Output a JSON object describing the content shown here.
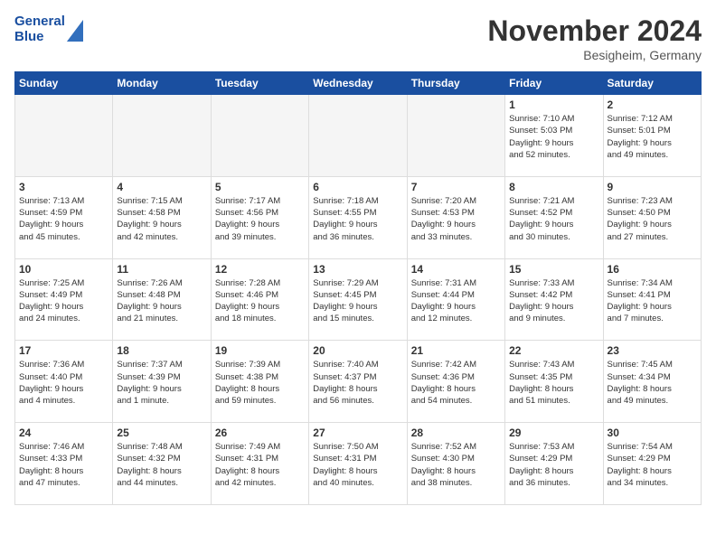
{
  "header": {
    "logo_line1": "General",
    "logo_line2": "Blue",
    "month_title": "November 2024",
    "location": "Besigheim, Germany"
  },
  "days_of_week": [
    "Sunday",
    "Monday",
    "Tuesday",
    "Wednesday",
    "Thursday",
    "Friday",
    "Saturday"
  ],
  "weeks": [
    [
      {
        "day": "",
        "info": ""
      },
      {
        "day": "",
        "info": ""
      },
      {
        "day": "",
        "info": ""
      },
      {
        "day": "",
        "info": ""
      },
      {
        "day": "",
        "info": ""
      },
      {
        "day": "1",
        "info": "Sunrise: 7:10 AM\nSunset: 5:03 PM\nDaylight: 9 hours\nand 52 minutes."
      },
      {
        "day": "2",
        "info": "Sunrise: 7:12 AM\nSunset: 5:01 PM\nDaylight: 9 hours\nand 49 minutes."
      }
    ],
    [
      {
        "day": "3",
        "info": "Sunrise: 7:13 AM\nSunset: 4:59 PM\nDaylight: 9 hours\nand 45 minutes."
      },
      {
        "day": "4",
        "info": "Sunrise: 7:15 AM\nSunset: 4:58 PM\nDaylight: 9 hours\nand 42 minutes."
      },
      {
        "day": "5",
        "info": "Sunrise: 7:17 AM\nSunset: 4:56 PM\nDaylight: 9 hours\nand 39 minutes."
      },
      {
        "day": "6",
        "info": "Sunrise: 7:18 AM\nSunset: 4:55 PM\nDaylight: 9 hours\nand 36 minutes."
      },
      {
        "day": "7",
        "info": "Sunrise: 7:20 AM\nSunset: 4:53 PM\nDaylight: 9 hours\nand 33 minutes."
      },
      {
        "day": "8",
        "info": "Sunrise: 7:21 AM\nSunset: 4:52 PM\nDaylight: 9 hours\nand 30 minutes."
      },
      {
        "day": "9",
        "info": "Sunrise: 7:23 AM\nSunset: 4:50 PM\nDaylight: 9 hours\nand 27 minutes."
      }
    ],
    [
      {
        "day": "10",
        "info": "Sunrise: 7:25 AM\nSunset: 4:49 PM\nDaylight: 9 hours\nand 24 minutes."
      },
      {
        "day": "11",
        "info": "Sunrise: 7:26 AM\nSunset: 4:48 PM\nDaylight: 9 hours\nand 21 minutes."
      },
      {
        "day": "12",
        "info": "Sunrise: 7:28 AM\nSunset: 4:46 PM\nDaylight: 9 hours\nand 18 minutes."
      },
      {
        "day": "13",
        "info": "Sunrise: 7:29 AM\nSunset: 4:45 PM\nDaylight: 9 hours\nand 15 minutes."
      },
      {
        "day": "14",
        "info": "Sunrise: 7:31 AM\nSunset: 4:44 PM\nDaylight: 9 hours\nand 12 minutes."
      },
      {
        "day": "15",
        "info": "Sunrise: 7:33 AM\nSunset: 4:42 PM\nDaylight: 9 hours\nand 9 minutes."
      },
      {
        "day": "16",
        "info": "Sunrise: 7:34 AM\nSunset: 4:41 PM\nDaylight: 9 hours\nand 7 minutes."
      }
    ],
    [
      {
        "day": "17",
        "info": "Sunrise: 7:36 AM\nSunset: 4:40 PM\nDaylight: 9 hours\nand 4 minutes."
      },
      {
        "day": "18",
        "info": "Sunrise: 7:37 AM\nSunset: 4:39 PM\nDaylight: 9 hours\nand 1 minute."
      },
      {
        "day": "19",
        "info": "Sunrise: 7:39 AM\nSunset: 4:38 PM\nDaylight: 8 hours\nand 59 minutes."
      },
      {
        "day": "20",
        "info": "Sunrise: 7:40 AM\nSunset: 4:37 PM\nDaylight: 8 hours\nand 56 minutes."
      },
      {
        "day": "21",
        "info": "Sunrise: 7:42 AM\nSunset: 4:36 PM\nDaylight: 8 hours\nand 54 minutes."
      },
      {
        "day": "22",
        "info": "Sunrise: 7:43 AM\nSunset: 4:35 PM\nDaylight: 8 hours\nand 51 minutes."
      },
      {
        "day": "23",
        "info": "Sunrise: 7:45 AM\nSunset: 4:34 PM\nDaylight: 8 hours\nand 49 minutes."
      }
    ],
    [
      {
        "day": "24",
        "info": "Sunrise: 7:46 AM\nSunset: 4:33 PM\nDaylight: 8 hours\nand 47 minutes."
      },
      {
        "day": "25",
        "info": "Sunrise: 7:48 AM\nSunset: 4:32 PM\nDaylight: 8 hours\nand 44 minutes."
      },
      {
        "day": "26",
        "info": "Sunrise: 7:49 AM\nSunset: 4:31 PM\nDaylight: 8 hours\nand 42 minutes."
      },
      {
        "day": "27",
        "info": "Sunrise: 7:50 AM\nSunset: 4:31 PM\nDaylight: 8 hours\nand 40 minutes."
      },
      {
        "day": "28",
        "info": "Sunrise: 7:52 AM\nSunset: 4:30 PM\nDaylight: 8 hours\nand 38 minutes."
      },
      {
        "day": "29",
        "info": "Sunrise: 7:53 AM\nSunset: 4:29 PM\nDaylight: 8 hours\nand 36 minutes."
      },
      {
        "day": "30",
        "info": "Sunrise: 7:54 AM\nSunset: 4:29 PM\nDaylight: 8 hours\nand 34 minutes."
      }
    ]
  ]
}
